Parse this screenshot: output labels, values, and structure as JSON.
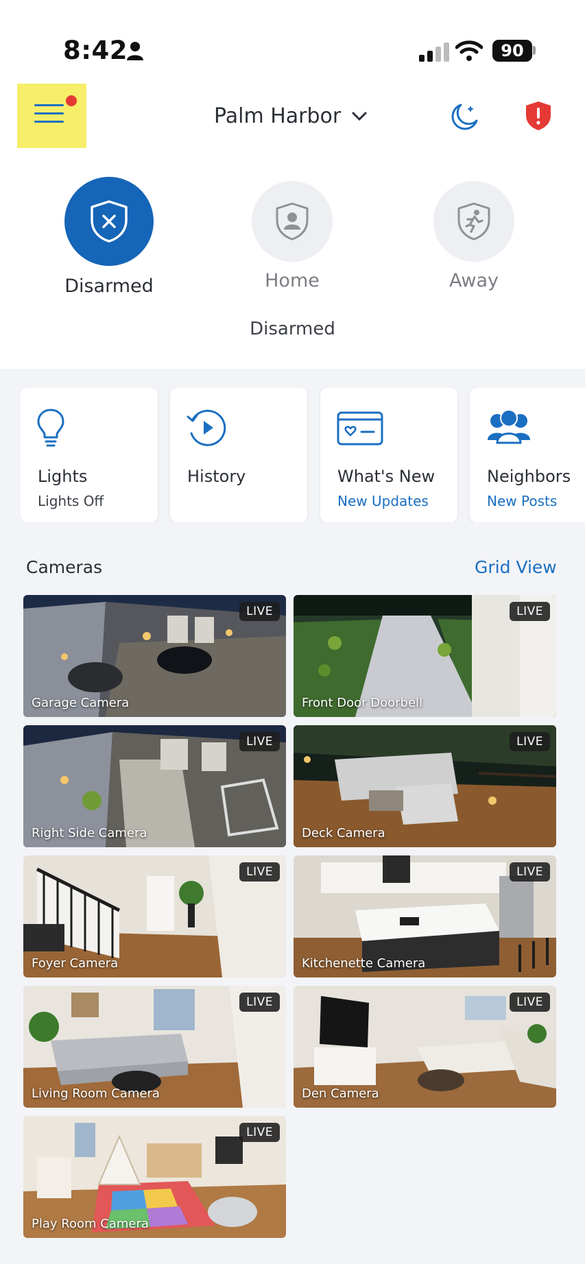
{
  "status_bar": {
    "time": "8:42",
    "battery": "90"
  },
  "header": {
    "location": "Palm Harbor"
  },
  "modes": [
    {
      "label": "Disarmed"
    },
    {
      "label": "Home"
    },
    {
      "label": "Away"
    }
  ],
  "mode_status": "Disarmed",
  "tiles": [
    {
      "title": "Lights",
      "subtitle": "Lights Off"
    },
    {
      "title": "History",
      "subtitle": ""
    },
    {
      "title": "What's New",
      "subtitle": "New Updates"
    },
    {
      "title": "Neighbors",
      "subtitle": "New Posts"
    }
  ],
  "cameras": {
    "title": "Cameras",
    "grid_view": "Grid View",
    "live_label": "LIVE",
    "items": [
      {
        "name": "Garage Camera"
      },
      {
        "name": "Front Door Doorbell"
      },
      {
        "name": "Right Side Camera"
      },
      {
        "name": "Deck Camera"
      },
      {
        "name": "Foyer Camera"
      },
      {
        "name": "Kitchenette Camera"
      },
      {
        "name": "Living Room Camera"
      },
      {
        "name": "Den Camera"
      },
      {
        "name": "Play Room Camera"
      }
    ]
  },
  "colors": {
    "accent": "#1a6fc2",
    "armed_blue": "#1565b8",
    "alert_red": "#e53935",
    "highlight": "#f7ee6a"
  }
}
